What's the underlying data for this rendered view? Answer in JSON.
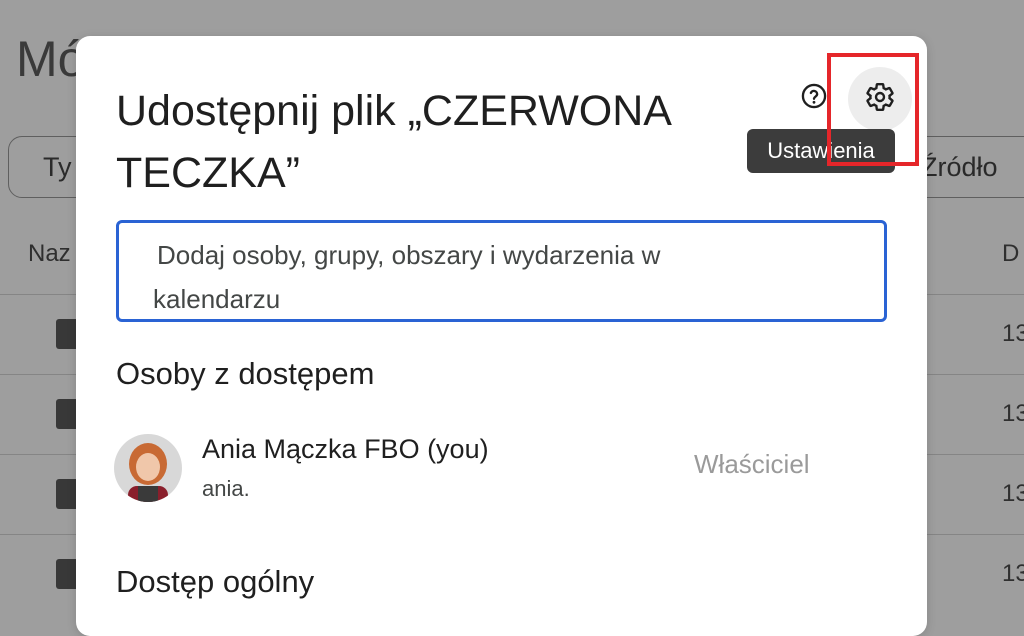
{
  "background": {
    "page_title": "Mó",
    "filter_type": "Ty",
    "filter_source": "Źródło",
    "column_name": "Naz",
    "column_date": "D",
    "row_dates": [
      "13",
      "13",
      "13",
      "13"
    ]
  },
  "dialog": {
    "title": "Udostępnij plik „CZERWONA TECZKA”",
    "help_icon": "help-circle-icon",
    "settings_icon": "gear-icon",
    "settings_tooltip": "Ustawienia",
    "share_input": {
      "placeholder_line1": "Dodaj osoby, grupy, obszary i wydarzenia w",
      "placeholder_line2": "kalendarzu"
    },
    "people_section_title": "Osoby z dostępem",
    "people": [
      {
        "name": "Ania Mączka FBO (you)",
        "email": "ania.",
        "role": "Właściciel"
      }
    ],
    "general_access_title": "Dostęp ogólny"
  },
  "colors": {
    "highlight": "#e5262a",
    "input_focus": "#2a63d4",
    "tooltip_bg": "#3c3c3c"
  }
}
